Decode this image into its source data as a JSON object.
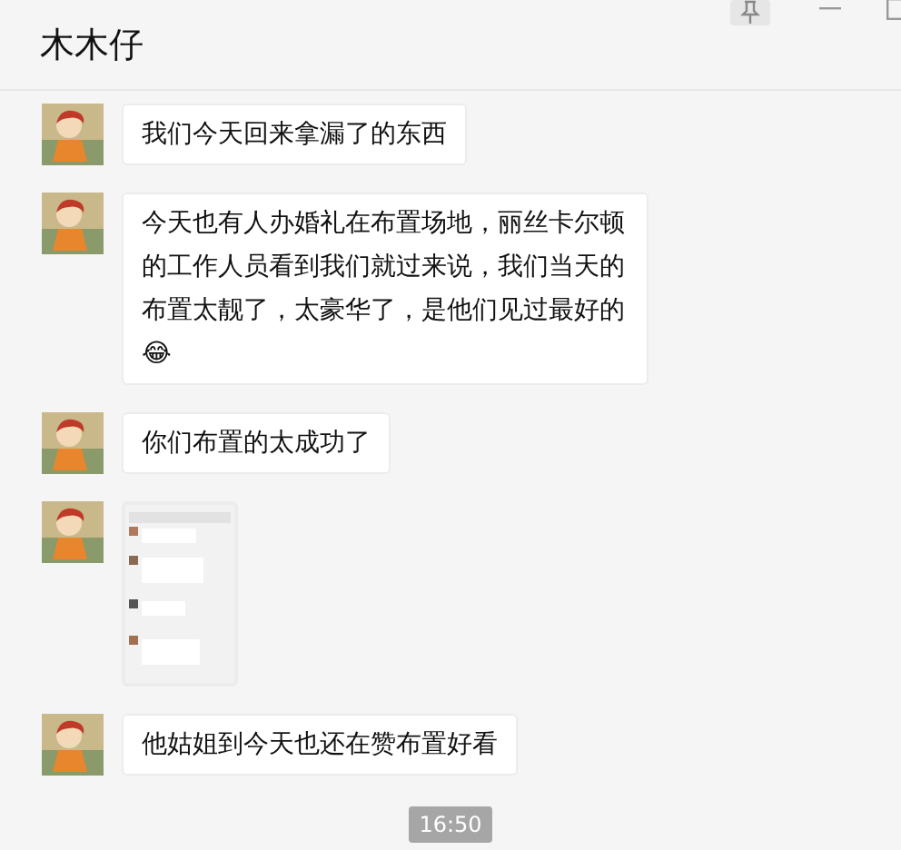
{
  "window": {
    "title": "木木仔"
  },
  "messages": [
    {
      "kind": "text",
      "text": "我们今天回来拿漏了的东西"
    },
    {
      "kind": "text",
      "text": "今天也有人办婚礼在布置场地，丽丝卡尔顿的工作人员看到我们就过来说，我们当天的布置太靓了，太豪华了，是他们见过最好的😂"
    },
    {
      "kind": "text",
      "text": "你们布置的太成功了"
    },
    {
      "kind": "picture"
    },
    {
      "kind": "text",
      "text": "他姑姐到今天也还在赞布置好看"
    }
  ],
  "timestamp": "16:50"
}
